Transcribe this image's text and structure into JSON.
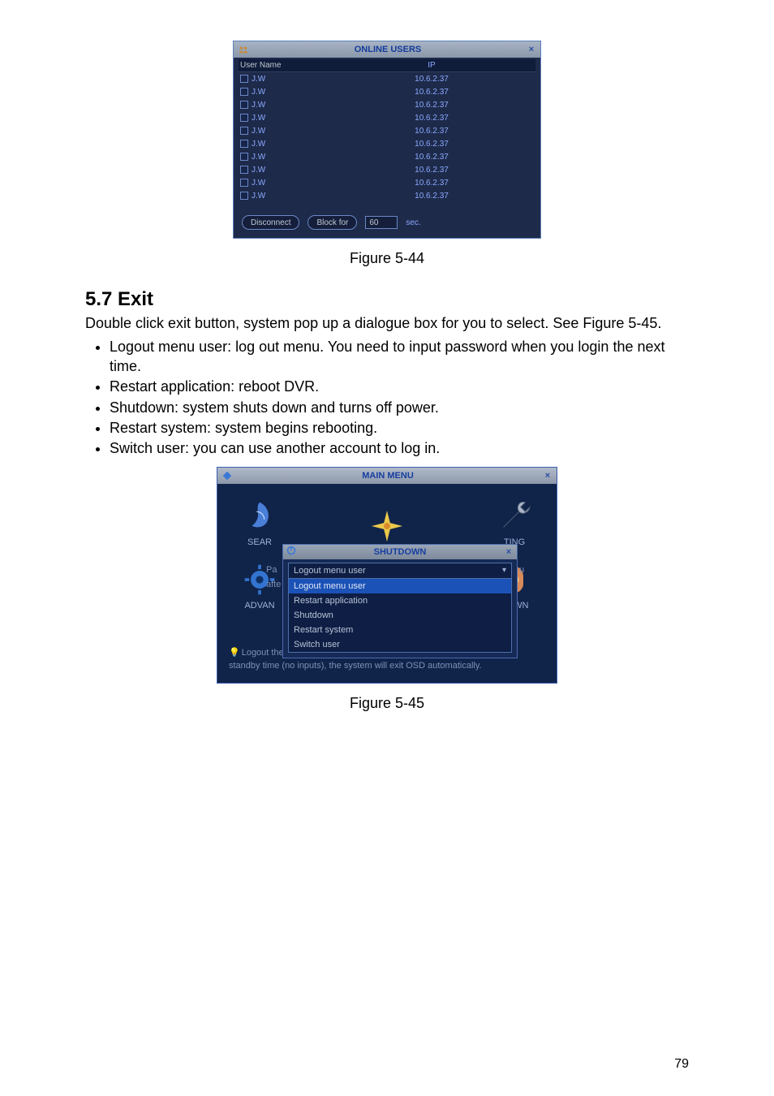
{
  "page_number": "79",
  "online_users": {
    "title": "ONLINE USERS",
    "col_user": "User Name",
    "col_ip": "IP",
    "rows": [
      {
        "name": "J.W",
        "ip": "10.6.2.37"
      },
      {
        "name": "J.W",
        "ip": "10.6.2.37"
      },
      {
        "name": "J.W",
        "ip": "10.6.2.37"
      },
      {
        "name": "J.W",
        "ip": "10.6.2.37"
      },
      {
        "name": "J.W",
        "ip": "10.6.2.37"
      },
      {
        "name": "J.W",
        "ip": "10.6.2.37"
      },
      {
        "name": "J.W",
        "ip": "10.6.2.37"
      },
      {
        "name": "J.W",
        "ip": "10.6.2.37"
      },
      {
        "name": "J.W",
        "ip": "10.6.2.37"
      },
      {
        "name": "J.W",
        "ip": "10.6.2.37"
      }
    ],
    "disconnect": "Disconnect",
    "block_for": "Block for",
    "block_secs": "60",
    "sec_label": "sec."
  },
  "fig544_caption": "Figure 5-44",
  "section_57": {
    "heading": "5.7  Exit",
    "para1": "Double click exit button, system pop up a dialogue box for you to select. See Figure 5-45.",
    "bullets": [
      "Logout menu user: log out menu. You need to input password when you login the next time.",
      "Restart application: reboot DVR.",
      "Shutdown: system shuts down and turns off power.",
      " Restart system: system begins rebooting.",
      "Switch user: you can use another account to log in."
    ]
  },
  "main_menu": {
    "title": "MAIN MENU",
    "items_row1": [
      {
        "label": "SEAR",
        "key": "search"
      },
      {
        "label": "",
        "key": "info"
      },
      {
        "label": "TING",
        "key": "setting"
      }
    ],
    "items_row2": [
      {
        "label": "ADVAN",
        "key": "advanced"
      },
      {
        "label": "",
        "key": "backup"
      },
      {
        "label": "DOWN",
        "key": "shutdown"
      }
    ]
  },
  "shutdown": {
    "title": "SHUTDOWN",
    "selected": "Logout menu user",
    "options": [
      "Logout menu user",
      "Restart application",
      "Shutdown",
      "Restart system",
      "Switch user"
    ],
    "pa_fragment": "Pa",
    "afte_fragment": "afte",
    "u_fragment": "u"
  },
  "hint_line1": "Logout the OSD menu or reset/restart the system. After idle for",
  "hint_line2": "standby time (no inputs), the system will exit OSD automatically.",
  "fig545_caption": "Figure 5-45",
  "icons": {
    "close_x": "×",
    "chevron_down": "▾",
    "bulb": "💡"
  }
}
